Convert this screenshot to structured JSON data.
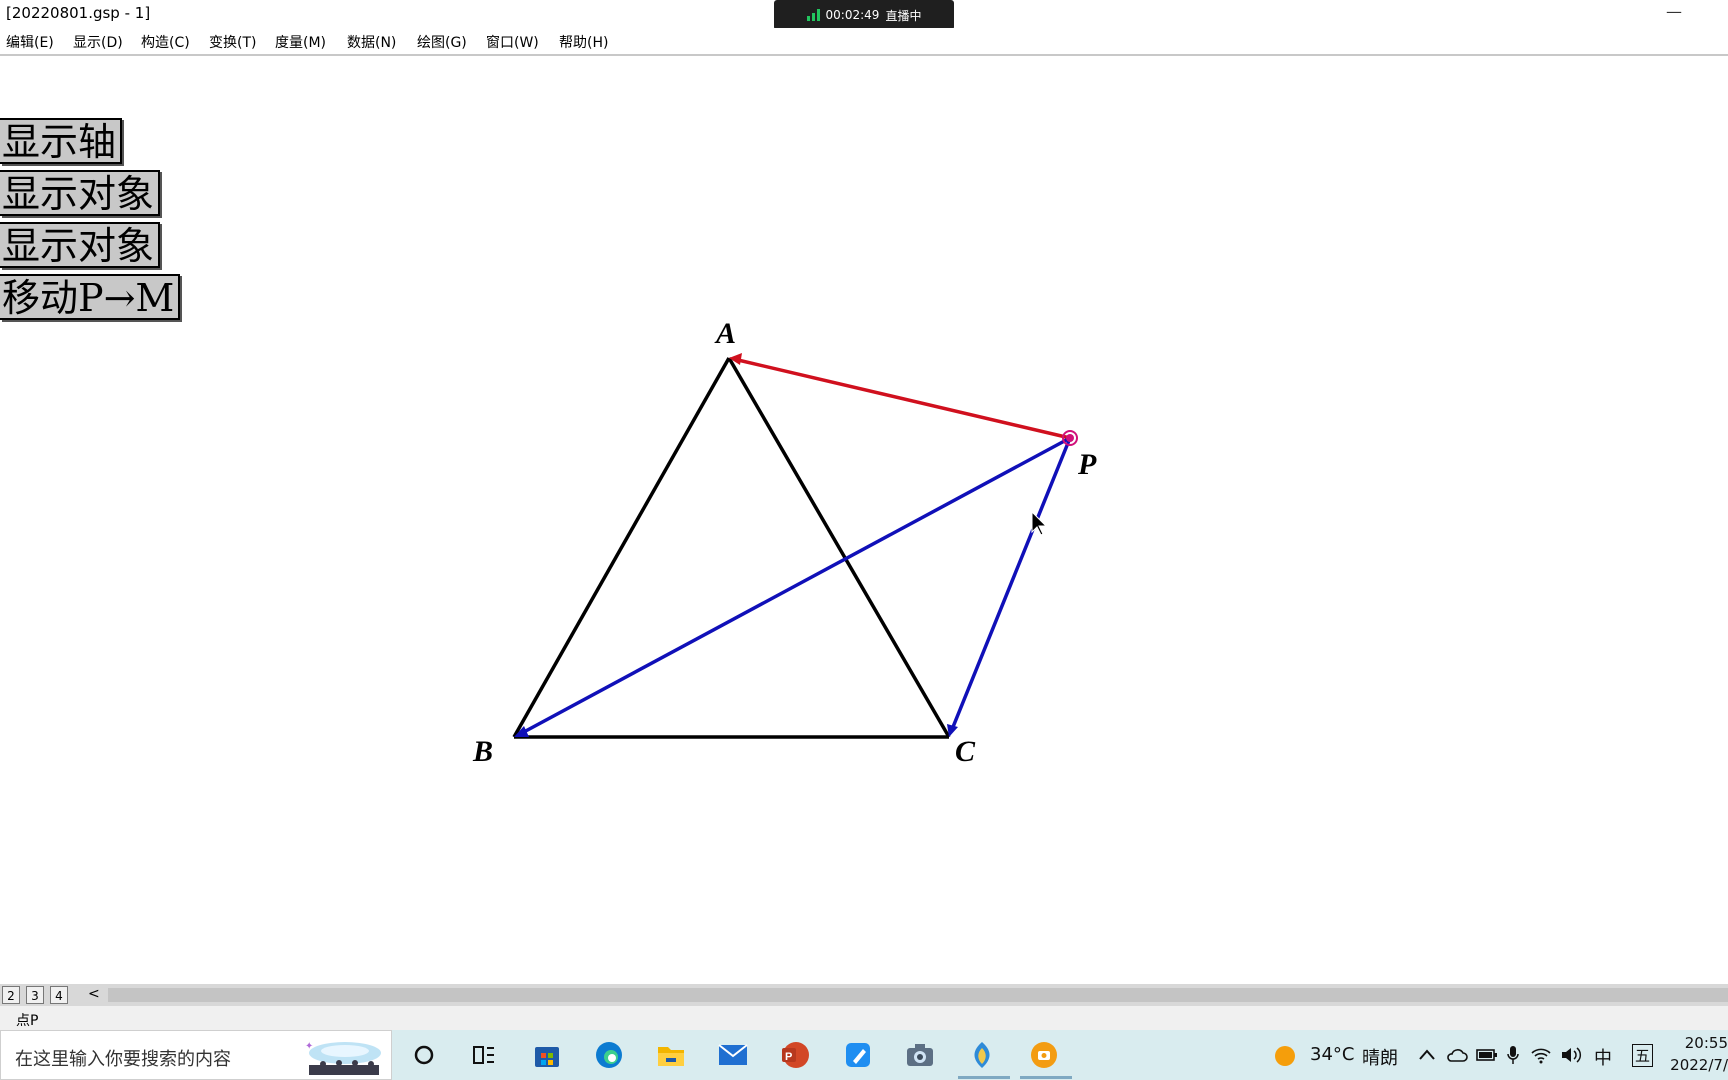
{
  "window": {
    "title": "[20220801.gsp - 1]",
    "minimize_glyph": "—"
  },
  "live_badge": {
    "time": "00:02:49",
    "status": "直播中",
    "icon": "signal-bars-icon"
  },
  "menu": [
    {
      "label": "编辑(E)"
    },
    {
      "label": "显示(D)"
    },
    {
      "label": "构造(C)"
    },
    {
      "label": "变换(T)"
    },
    {
      "label": "度量(M)"
    },
    {
      "label": "数据(N)"
    },
    {
      "label": "绘图(G)"
    },
    {
      "label": "窗口(W)"
    },
    {
      "label": "帮助(H)"
    }
  ],
  "action_buttons": [
    {
      "label": "显示轴"
    },
    {
      "label": "显示对象"
    },
    {
      "label": "显示对象"
    },
    {
      "label": "移动P→M"
    }
  ],
  "sketch": {
    "points": {
      "A": {
        "label": "A"
      },
      "B": {
        "label": "B"
      },
      "C": {
        "label": "C"
      },
      "P": {
        "label": "P"
      }
    },
    "colors": {
      "triangle": "#000000",
      "vector_red": "#d0101e",
      "vector_blue": "#1010b8",
      "point_p": "#d0107a"
    }
  },
  "page_tabs": [
    {
      "label": "2"
    },
    {
      "label": "3"
    },
    {
      "label": "4"
    }
  ],
  "scroll_left_glyph": "<",
  "status": {
    "text": "点P"
  },
  "taskbar": {
    "search_placeholder": "在这里输入你要搜索的内容",
    "apps": [
      "cortana-icon",
      "task-view-icon",
      "store-icon",
      "edge-icon",
      "file-explorer-icon",
      "mail-icon",
      "powerpoint-icon",
      "pen-app-icon",
      "camera-icon",
      "sketchpad-icon",
      "screenshot-app-icon"
    ],
    "weather": {
      "temp": "34°C",
      "condition": "晴朗"
    },
    "ime": "中",
    "ime_mode": "五",
    "clock": {
      "time": "20:55",
      "date": "2022/7/"
    }
  }
}
